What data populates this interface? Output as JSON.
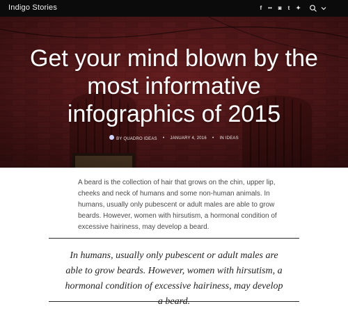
{
  "header": {
    "site_title": "Indigo Stories",
    "social": [
      {
        "icon": "facebook-icon",
        "glyph": "f"
      },
      {
        "icon": "flickr-icon",
        "glyph": "••"
      },
      {
        "icon": "instagram-icon",
        "glyph": "◙"
      },
      {
        "icon": "tumblr-icon",
        "glyph": "t"
      },
      {
        "icon": "twitter-icon",
        "glyph": "✦"
      }
    ],
    "search_icon": "search-icon",
    "menu_icon": "chevron-down-icon"
  },
  "hero": {
    "title": "Get your mind blown by the most informative infographics of 2015",
    "author": "BY QUADRO IDEAS",
    "date": "JANUARY 4, 2016",
    "category": "IN IDEAS",
    "separator": "•"
  },
  "article": {
    "paragraph": "A beard is the collection of hair that grows on the chin, upper lip, cheeks and neck of humans and some non-human animals. In humans, usually only pubescent or adult males are able to grow beards. However, women with hirsutism, a hormonal condition of excessive hairiness, may develop a beard.",
    "pullquote": "In humans, usually only pubescent or adult males are able to grow beards. However, women with hirsutism, a hormonal condition of excessive hairiness, may develop a beard."
  },
  "colors": {
    "topbar": "#0b0b0b",
    "brick": "#6b1f1f",
    "text": "#4a4a4a"
  }
}
